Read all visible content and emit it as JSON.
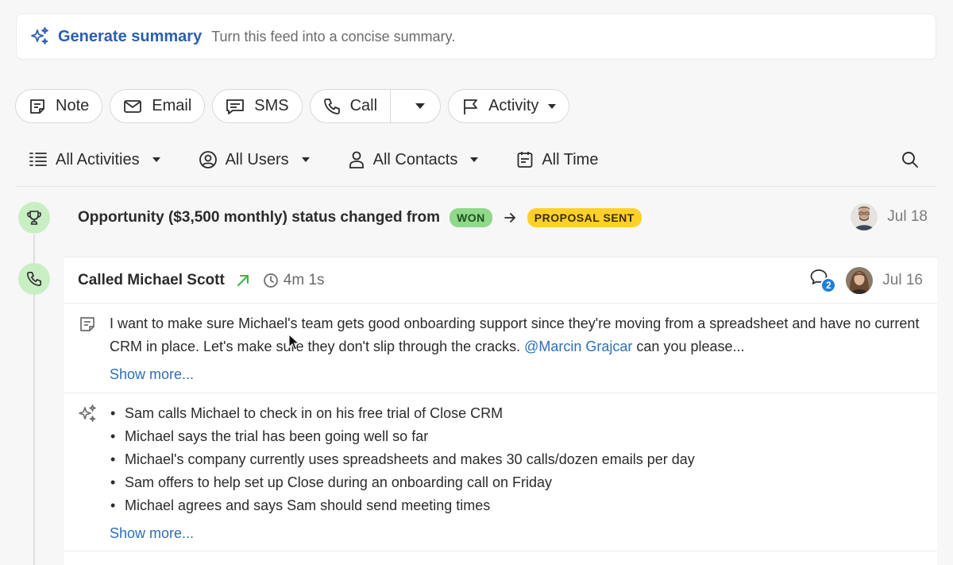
{
  "summary": {
    "title": "Generate summary",
    "subtitle": "Turn this feed into a concise summary."
  },
  "actions": {
    "note": "Note",
    "email": "Email",
    "sms": "SMS",
    "call": "Call",
    "activity": "Activity"
  },
  "filters": {
    "activities": "All Activities",
    "users": "All Users",
    "contacts": "All Contacts",
    "time": "All Time"
  },
  "opportunity": {
    "text": "Opportunity ($3,500 monthly) status changed from",
    "from_status": "WON",
    "to_status": "PROPOSAL SENT",
    "date": "Jul 18"
  },
  "call": {
    "title": "Called Michael Scott",
    "duration": "4m 1s",
    "comment_count": "2",
    "date": "Jul 16",
    "note_part1": "I want to make sure Michael's team gets good onboarding support since they're moving from a spreadsheet and have no current CRM in place. Let's make sure they don't slip through the cracks. ",
    "note_mention": "@Marcin Grajcar",
    "note_part2": " can you please...",
    "show_more": "Show more...",
    "summary_items": [
      "Sam calls Michael to check in on his free trial of Close CRM",
      "Michael says the trial has been going well so far",
      "Michael's company currently uses spreadsheets and makes 30 calls/dozen emails per day",
      "Sam offers to help set up Close during an onboarding call on Friday",
      "Michael agrees and says Sam should send meeting times"
    ],
    "summary_show_more": "Show more..."
  },
  "colors": {
    "accent": "#2a5fb0",
    "link": "#2e6fb5",
    "timeline_icon_bg": "#c9eec4",
    "won_badge": "#8fd98a",
    "proposal_badge": "#ffd02a",
    "comment_badge": "#1f7fd6"
  }
}
